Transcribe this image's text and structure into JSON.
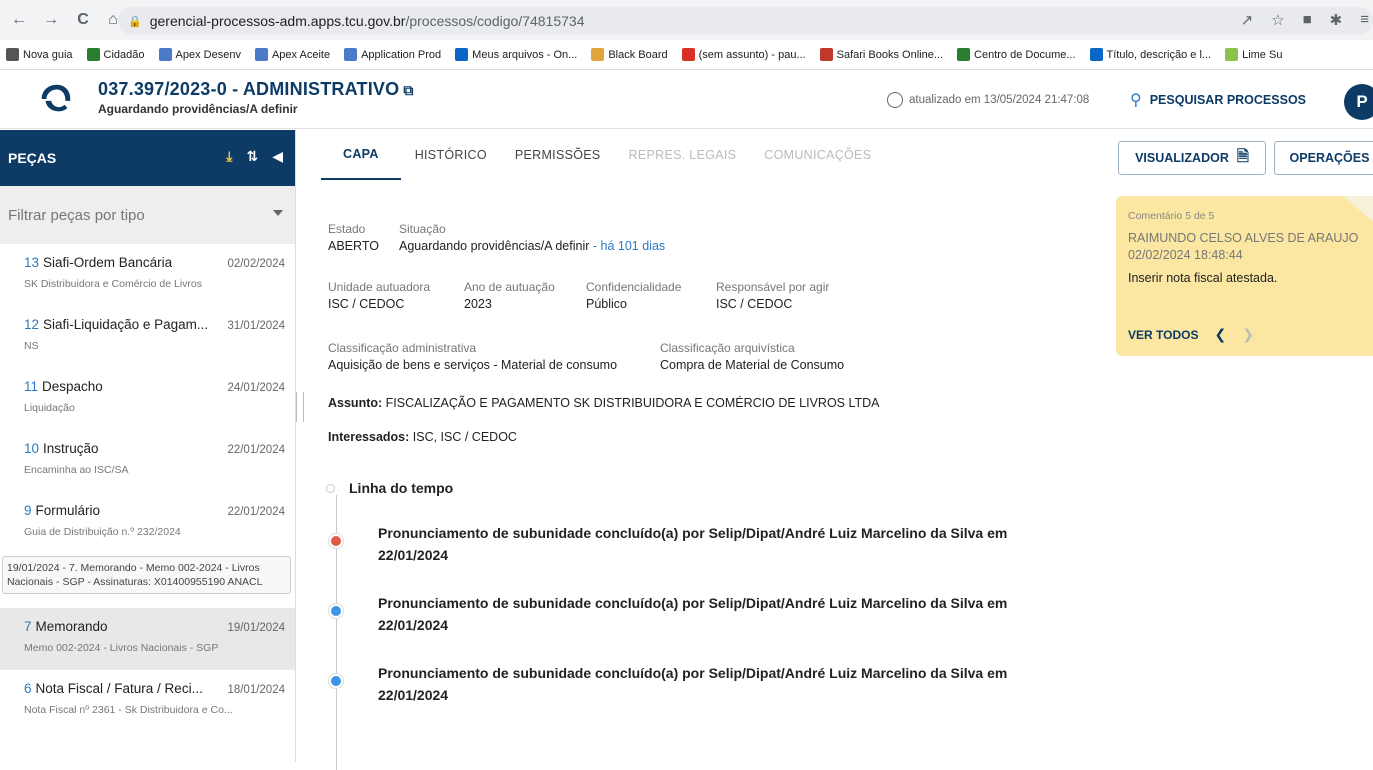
{
  "browser": {
    "url_host": "gerencial-processos-adm.apps.tcu.gov.br",
    "url_path": "/processos/codigo/74815734",
    "bookmarks": [
      {
        "label": "Nova guia",
        "color": "#555555"
      },
      {
        "label": "Cidadão",
        "color": "#2a7d2e"
      },
      {
        "label": "Apex Desenv",
        "color": "#4a7bc8"
      },
      {
        "label": "Apex Aceite",
        "color": "#4a7bc8"
      },
      {
        "label": "Application Prod",
        "color": "#4a7bc8"
      },
      {
        "label": "Meus arquivos - On...",
        "color": "#0a67c8"
      },
      {
        "label": "Black Board",
        "color": "#e2a43a"
      },
      {
        "label": "(sem assunto) - pau...",
        "color": "#d93025"
      },
      {
        "label": "Safari Books Online...",
        "color": "#c0392b"
      },
      {
        "label": "Centro de Docume...",
        "color": "#2a7d2e"
      },
      {
        "label": "Título, descrição e l...",
        "color": "#0a67c8"
      },
      {
        "label": "Lime Su",
        "color": "#8bc34a"
      }
    ]
  },
  "header": {
    "process_title": "037.397/2023-0 - ADMINISTRATIVO",
    "status": "Aguardando providências/A definir",
    "updated": "atualizado em 13/05/2024 21:47:08",
    "search_label": "PESQUISAR PROCESSOS",
    "avatar_initial": "P"
  },
  "left_panel": {
    "title": "PEÇAS",
    "filter_placeholder": "Filtrar peças por tipo",
    "pieces": [
      {
        "num": "13",
        "title": "Siafi-Ordem Bancária",
        "date": "02/02/2024",
        "desc": "SK Distribuidora e Comércio de Livros"
      },
      {
        "num": "12",
        "title": "Siafi-Liquidação e Pagam...",
        "date": "31/01/2024",
        "desc": "NS"
      },
      {
        "num": "11",
        "title": "Despacho",
        "date": "24/01/2024",
        "desc": "Liquidação"
      },
      {
        "num": "10",
        "title": "Instrução",
        "date": "22/01/2024",
        "desc": "Encaminha ao ISC/SA"
      },
      {
        "num": "9",
        "title": "Formulário",
        "date": "22/01/2024",
        "desc": "Guia de Distribuição n.º 232/2024"
      }
    ],
    "tooltip": "19/01/2024 - 7. Memorando - Memo 002-2024 - Livros Nacionais - SGP - Assinaturas: X01400955190 ANACL",
    "pieces_after": [
      {
        "num": "7",
        "title": "Memorando",
        "date": "19/01/2024",
        "desc": "Memo 002-2024 - Livros Nacionais - SGP"
      },
      {
        "num": "6",
        "title": "Nota Fiscal / Fatura / Reci...",
        "date": "18/01/2024",
        "desc": "Nota Fiscal nº 2361 - Sk Distribuidora e Co..."
      }
    ]
  },
  "tabs": [
    "CAPA",
    "HISTÓRICO",
    "PERMISSÕES",
    "REPRES. LEGAIS",
    "COMUNICAÇÕES"
  ],
  "buttons": {
    "viewer": "VISUALIZADOR",
    "operations": "OPERAÇÕES"
  },
  "capa": {
    "estado_label": "Estado",
    "estado": "ABERTO",
    "situacao_label": "Situação",
    "situacao": "Aguardando providências/A definir",
    "situacao_age": "- há 101 dias",
    "unidade_label": "Unidade autuadora",
    "unidade": "ISC / CEDOC",
    "ano_label": "Ano de autuação",
    "ano": "2023",
    "conf_label": "Confidencialidade",
    "conf": "Público",
    "resp_label": "Responsável por agir",
    "resp": "ISC / CEDOC",
    "class_adm_label": "Classificação administrativa",
    "class_adm": "Aquisição de bens e serviços - Material de consumo",
    "class_arq_label": "Classificação arquivística",
    "class_arq": "Compra de Material de Consumo",
    "assunto_label": "Assunto:",
    "assunto": "FISCALIZAÇÃO E PAGAMENTO SK DISTRIBUIDORA E COMÉRCIO DE LIVROS LTDA",
    "interessados_label": "Interessados:",
    "interessados": "ISC, ISC / CEDOC"
  },
  "timeline": {
    "title": "Linha do tempo",
    "items": [
      {
        "text": "Pronunciamento de subunidade concluído(a) por Selip/Dipat/André Luiz Marcelino da Silva em 22/01/2024",
        "color": "#e05a47"
      },
      {
        "text": "Pronunciamento de subunidade concluído(a) por Selip/Dipat/André Luiz Marcelino da Silva em 22/01/2024",
        "color": "#3b94e6"
      },
      {
        "text": "Pronunciamento de subunidade concluído(a) por Selip/Dipat/André Luiz Marcelino da Silva em 22/01/2024",
        "color": "#3b94e6"
      }
    ]
  },
  "comment": {
    "counter": "Comentário 5 de 5",
    "author": "RAIMUNDO CELSO ALVES DE ARAUJO",
    "datetime": "02/02/2024 18:48:44",
    "text": "Inserir nota fiscal atestada.",
    "see_all": "VER TODOS"
  }
}
